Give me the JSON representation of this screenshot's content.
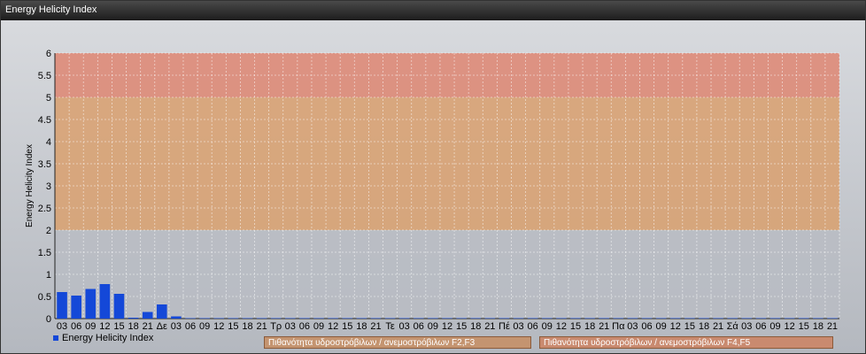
{
  "window": {
    "title": "Energy Helicity Index"
  },
  "legend": {
    "series_label": "Energy Helicity Index",
    "series_color": "#1448d8"
  },
  "bands": {
    "low_label": "Πιθανότητα υδροστρόβιλων / ανεμοστρόβιλων F2,F3",
    "high_label": "Πιθανότητα υδροστρόβιλων / ανεμοστρόβιλων F4,F5",
    "colors": {
      "none": "#b9bcc3",
      "moderate": "#d9a06e",
      "high": "#de8672"
    }
  },
  "chart_data": {
    "type": "bar",
    "title": "",
    "xlabel": "",
    "ylabel": "Energy Helicity Index",
    "ylim": [
      0,
      6
    ],
    "yticks": [
      "0",
      "0.5",
      "1",
      "1.5",
      "2",
      "2.5",
      "3",
      "3.5",
      "4",
      "4.5",
      "5",
      "5.5",
      "6"
    ],
    "grid": true,
    "band_ranges": [
      [
        0,
        2,
        "none"
      ],
      [
        2,
        5,
        "moderate"
      ],
      [
        5,
        6,
        "high"
      ]
    ],
    "categories": [
      "03",
      "06",
      "09",
      "12",
      "15",
      "18",
      "21",
      "Δε",
      "03",
      "06",
      "09",
      "12",
      "15",
      "18",
      "21",
      "Τρ",
      "03",
      "06",
      "09",
      "12",
      "15",
      "18",
      "21",
      "Τε",
      "03",
      "06",
      "09",
      "12",
      "15",
      "18",
      "21",
      "Πέ",
      "03",
      "06",
      "09",
      "12",
      "15",
      "18",
      "21",
      "Πα",
      "03",
      "06",
      "09",
      "12",
      "15",
      "18",
      "21",
      "Σά",
      "03",
      "06",
      "09",
      "12",
      "15",
      "18",
      "21"
    ],
    "series": [
      {
        "name": "Energy Helicity Index",
        "values": [
          0.6,
          0.52,
          0.67,
          0.78,
          0.56,
          0.02,
          0.15,
          0.32,
          0.05,
          0.01,
          0.01,
          0.01,
          0.01,
          0.01,
          0.01,
          0.01,
          0.01,
          0.01,
          0.01,
          0.01,
          0.01,
          0.01,
          0.01,
          0.01,
          0.01,
          0.01,
          0.01,
          0.01,
          0.01,
          0.01,
          0.01,
          0.01,
          0.01,
          0.01,
          0.01,
          0.01,
          0.01,
          0.01,
          0.01,
          0.01,
          0.01,
          0.01,
          0.01,
          0.01,
          0.01,
          0.01,
          0.01,
          0.01,
          0.01,
          0.01,
          0.01,
          0.01,
          0.01,
          0.01,
          0.01
        ]
      }
    ]
  }
}
